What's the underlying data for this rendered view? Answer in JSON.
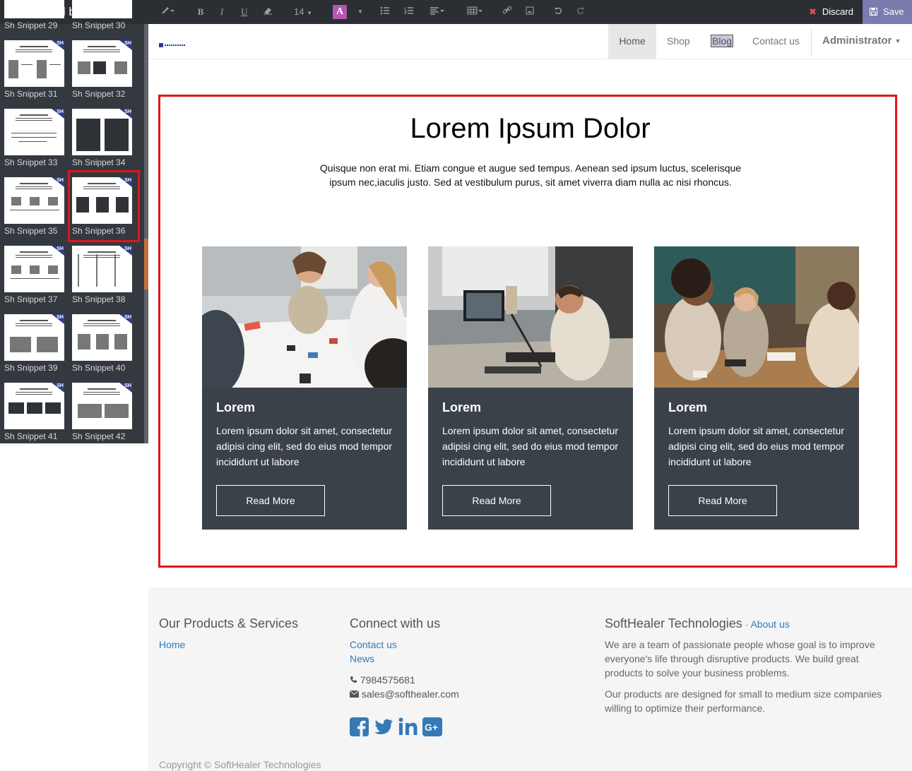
{
  "sidebar": {
    "title": "Add blocks",
    "snippets": [
      {
        "label": "Sh Snippet 29",
        "badge": "SH"
      },
      {
        "label": "Sh Snippet 30",
        "badge": "SH"
      },
      {
        "label": "Sh Snippet 31",
        "badge": "SH"
      },
      {
        "label": "Sh Snippet 32",
        "badge": "SH"
      },
      {
        "label": "Sh Snippet 33",
        "badge": "SH"
      },
      {
        "label": "Sh Snippet 34",
        "badge": "SH"
      },
      {
        "label": "Sh Snippet 35",
        "badge": "SH"
      },
      {
        "label": "Sh Snippet 36",
        "badge": "SH",
        "selected": true
      },
      {
        "label": "Sh Snippet 37",
        "badge": "SH"
      },
      {
        "label": "Sh Snippet 38",
        "badge": "SH"
      },
      {
        "label": "Sh Snippet 39",
        "badge": "SH"
      },
      {
        "label": "Sh Snippet 40",
        "badge": "SH"
      },
      {
        "label": "Sh Snippet 41",
        "badge": "SH"
      },
      {
        "label": "Sh Snippet 42",
        "badge": "SH"
      }
    ]
  },
  "toolbar": {
    "font_size": "14",
    "color_letter": "A",
    "discard_label": "Discard",
    "save_label": "Save"
  },
  "nav": {
    "items": [
      {
        "label": "Home",
        "active": true
      },
      {
        "label": "Shop"
      },
      {
        "label": "Blog"
      },
      {
        "label": "Contact us"
      }
    ],
    "user": "Administrator"
  },
  "section": {
    "title": "Lorem Ipsum Dolor",
    "intro": "Quisque non erat mi. Etiam congue et augue sed tempus. Aenean sed ipsum luctus, scelerisque ipsum nec,iaculis justo. Sed at vestibulum purus, sit amet viverra diam nulla ac nisi rhoncus.",
    "cards": [
      {
        "title": "Lorem",
        "body": "Lorem ipsum dolor sit amet, consectetur adipisi cing elit, sed do eius mod tempor incididunt ut labore",
        "button": "Read More"
      },
      {
        "title": "Lorem",
        "body": "Lorem ipsum dolor sit amet, consectetur adipisi cing elit, sed do eius mod tempor incididunt ut labore",
        "button": "Read More"
      },
      {
        "title": "Lorem",
        "body": "Lorem ipsum dolor sit amet, consectetur adipisi cing elit, sed do eius mod tempor incididunt ut labore",
        "button": "Read More"
      }
    ]
  },
  "footer": {
    "col1": {
      "heading": "Our Products & Services",
      "links": [
        "Home"
      ]
    },
    "col2": {
      "heading": "Connect with us",
      "links": [
        "Contact us",
        "News"
      ],
      "phone": "7984575681",
      "email": "sales@softhealer.com",
      "social_icons": [
        "facebook-icon",
        "twitter-icon",
        "linkedin-icon",
        "google-plus-icon"
      ]
    },
    "col3": {
      "heading": "SoftHealer Technologies",
      "heading_sep": " - ",
      "about_link": "About us",
      "p1": "We are a team of passionate people whose goal is to improve everyone's life through disruptive products. We build great products to solve your business problems.",
      "p2": "Our products are designed for small to medium size companies willing to optimize their performance."
    },
    "copyright": "Copyright © SoftHealer Technologies"
  },
  "colors": {
    "accent": "#7c7bad",
    "highlight": "#e1141c",
    "card": "#3a4149",
    "link": "#337ab7"
  }
}
